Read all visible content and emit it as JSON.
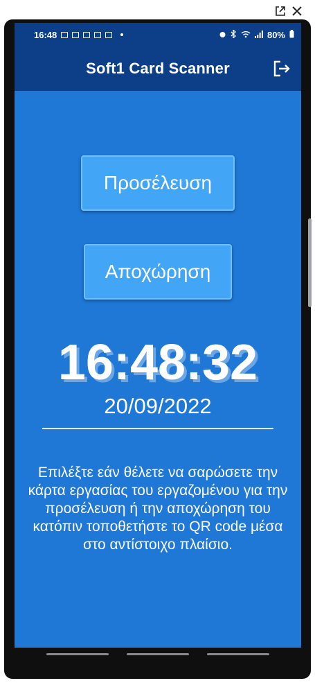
{
  "statusbar": {
    "time": "16:48",
    "battery": "80%"
  },
  "appbar": {
    "title": "Soft1 Card Scanner"
  },
  "buttons": {
    "arrival": "Προσέλευση",
    "departure": "Αποχώρηση"
  },
  "clock": {
    "time": "16:48:32",
    "date": "20/09/2022"
  },
  "instructions": "Επιλέξτε εάν θέλετε να σαρώσετε την κάρτα εργασίας του εργαζομένου για την προσέλευση ή την αποχώρηση του κατόπιν τοποθετήστε το QR code μέσα στο αντίστοιχο πλαίσιο.",
  "colors": {
    "background": "#1f77d6",
    "appbar": "#0c3f88",
    "button": "#42a5f5"
  },
  "icons": [
    "open-external-icon",
    "close-icon",
    "logout-icon",
    "alarm-icon",
    "bluetooth-icon",
    "wifi-icon",
    "signal-icon",
    "battery-icon"
  ]
}
